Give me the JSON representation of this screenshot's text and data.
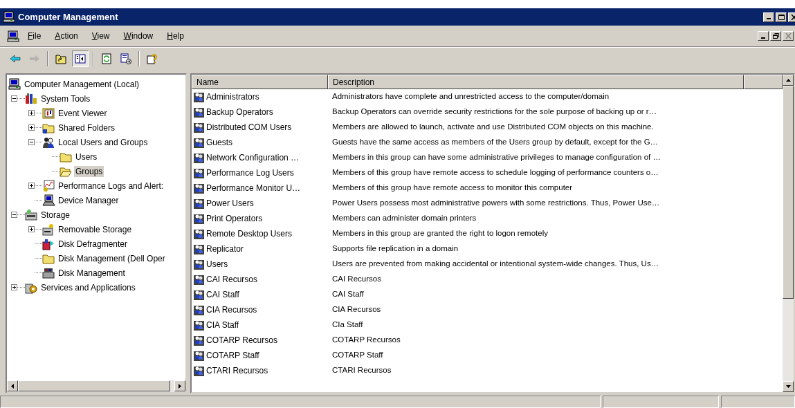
{
  "window": {
    "title": "Computer Management"
  },
  "menu": [
    "File",
    "Action",
    "View",
    "Window",
    "Help"
  ],
  "toolbar": [
    {
      "kind": "back",
      "disabled": false,
      "pressed": false
    },
    {
      "kind": "forward",
      "disabled": true,
      "pressed": false
    },
    {
      "kind": "separator"
    },
    {
      "kind": "up",
      "disabled": false,
      "pressed": false
    },
    {
      "kind": "tree-toggle",
      "disabled": false,
      "pressed": true
    },
    {
      "kind": "separator"
    },
    {
      "kind": "refresh",
      "disabled": false,
      "pressed": false
    },
    {
      "kind": "export",
      "disabled": false,
      "pressed": false
    },
    {
      "kind": "separator"
    },
    {
      "kind": "help",
      "disabled": false,
      "pressed": false
    }
  ],
  "tree": {
    "label": "Computer Management (Local)",
    "kind": "computer",
    "selected": false,
    "children": [
      {
        "label": "System Tools",
        "kind": "tools",
        "selected": false,
        "expanded": true,
        "children": [
          {
            "label": "Event Viewer",
            "kind": "log",
            "selected": false,
            "expanded": false
          },
          {
            "label": "Shared Folders",
            "kind": "share",
            "selected": false,
            "expanded": false
          },
          {
            "label": "Local Users and Groups",
            "kind": "users",
            "selected": false,
            "expanded": true,
            "children": [
              {
                "label": "Users",
                "kind": "folder",
                "selected": false
              },
              {
                "label": "Groups",
                "kind": "folder-open",
                "selected": true
              }
            ]
          },
          {
            "label": "Performance Logs and Alert:",
            "kind": "chart",
            "selected": false,
            "expanded": false
          },
          {
            "label": "Device Manager",
            "kind": "device",
            "selected": false
          }
        ]
      },
      {
        "label": "Storage",
        "kind": "storage",
        "selected": false,
        "expanded": true,
        "children": [
          {
            "label": "Removable Storage",
            "kind": "removable",
            "selected": false,
            "expanded": false
          },
          {
            "label": "Disk Defragmenter",
            "kind": "defrag",
            "selected": false
          },
          {
            "label": "Disk Management (Dell Oper",
            "kind": "folder",
            "selected": false
          },
          {
            "label": "Disk Management",
            "kind": "disk",
            "selected": false
          }
        ]
      },
      {
        "label": "Services and Applications",
        "kind": "services",
        "selected": false,
        "expanded": false
      }
    ]
  },
  "list": {
    "columns": [
      "Name",
      "Description"
    ],
    "rows": [
      {
        "name": "Administrators",
        "description": "Administrators have complete and unrestricted access to the computer/domain"
      },
      {
        "name": "Backup Operators",
        "description": "Backup Operators can override security restrictions for the sole purpose of backing up or r…"
      },
      {
        "name": "Distributed COM Users",
        "description": "Members are allowed to launch, activate and use Distributed COM objects on this machine."
      },
      {
        "name": "Guests",
        "description": "Guests have the same access as members of the Users group by default, except for the G…"
      },
      {
        "name": "Network Configuration …",
        "description": "Members in this group can have some administrative privileges to manage configuration of …"
      },
      {
        "name": "Performance Log Users",
        "description": "Members of this group have remote access to schedule logging of performance counters o…"
      },
      {
        "name": "Performance Monitor U…",
        "description": "Members of this group have remote access to monitor this computer"
      },
      {
        "name": "Power Users",
        "description": "Power Users possess most administrative powers with some restrictions.  Thus, Power Use…"
      },
      {
        "name": "Print Operators",
        "description": "Members can administer domain printers"
      },
      {
        "name": "Remote Desktop Users",
        "description": "Members in this group are granted the right to logon remotely"
      },
      {
        "name": "Replicator",
        "description": "Supports file replication in a domain"
      },
      {
        "name": "Users",
        "description": "Users are prevented from making accidental or intentional system-wide changes.  Thus, Us…"
      },
      {
        "name": "CAI Recursos",
        "description": "CAI Recursos"
      },
      {
        "name": "CAI Staff",
        "description": "CAI Staff"
      },
      {
        "name": "CIA Recursos",
        "description": "CIA Recursos"
      },
      {
        "name": "CIA Staff",
        "description": "CIa Staff"
      },
      {
        "name": "COTARP Recursos",
        "description": "COTARP Recursos"
      },
      {
        "name": "COTARP Staff",
        "description": "COTARP Staff"
      },
      {
        "name": "CTARI Recursos",
        "description": "CTARI Recursos"
      }
    ]
  }
}
